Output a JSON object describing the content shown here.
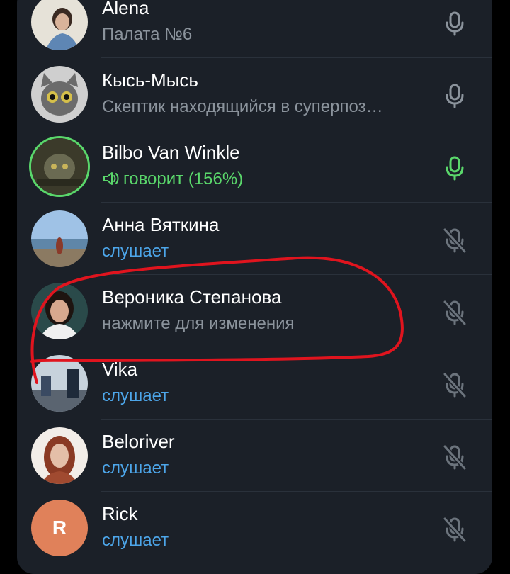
{
  "participants": [
    {
      "name": "Alena",
      "status": "Палата №6",
      "status_kind": "gray",
      "mic": "mic-icon",
      "mic_color": "#8b939c"
    },
    {
      "name": "Кысь-Мысь",
      "status": "Скептик находящийся в суперпоз…",
      "status_kind": "gray",
      "mic": "mic-icon",
      "mic_color": "#8b939c"
    },
    {
      "name": "Bilbo Van Winkle",
      "status": "говорит (156%)",
      "status_kind": "green",
      "mic": "mic-icon",
      "mic_color": "#5ad76b"
    },
    {
      "name": "Анна Вяткина",
      "status": "слушает",
      "status_kind": "blue",
      "mic": "mic-muted-icon",
      "mic_color": "#6c747d"
    },
    {
      "name": "Вероника Степанова",
      "status": "нажмите для изменения",
      "status_kind": "gray",
      "mic": "mic-muted-icon",
      "mic_color": "#6c747d"
    },
    {
      "name": "Vika",
      "status": "слушает",
      "status_kind": "blue",
      "mic": "mic-muted-icon",
      "mic_color": "#6c747d"
    },
    {
      "name": "Beloriver",
      "status": "слушает",
      "status_kind": "blue",
      "mic": "mic-muted-icon",
      "mic_color": "#6c747d"
    },
    {
      "name": "Rick",
      "status": "слушает",
      "status_kind": "blue",
      "mic": "mic-muted-icon",
      "mic_color": "#6c747d",
      "avatar_letter": "R"
    }
  ],
  "colors": {
    "panel_bg": "#1b2028",
    "speaking_green": "#5ad76b",
    "listening_blue": "#4da6ea",
    "annotation_red": "#e0141e"
  }
}
